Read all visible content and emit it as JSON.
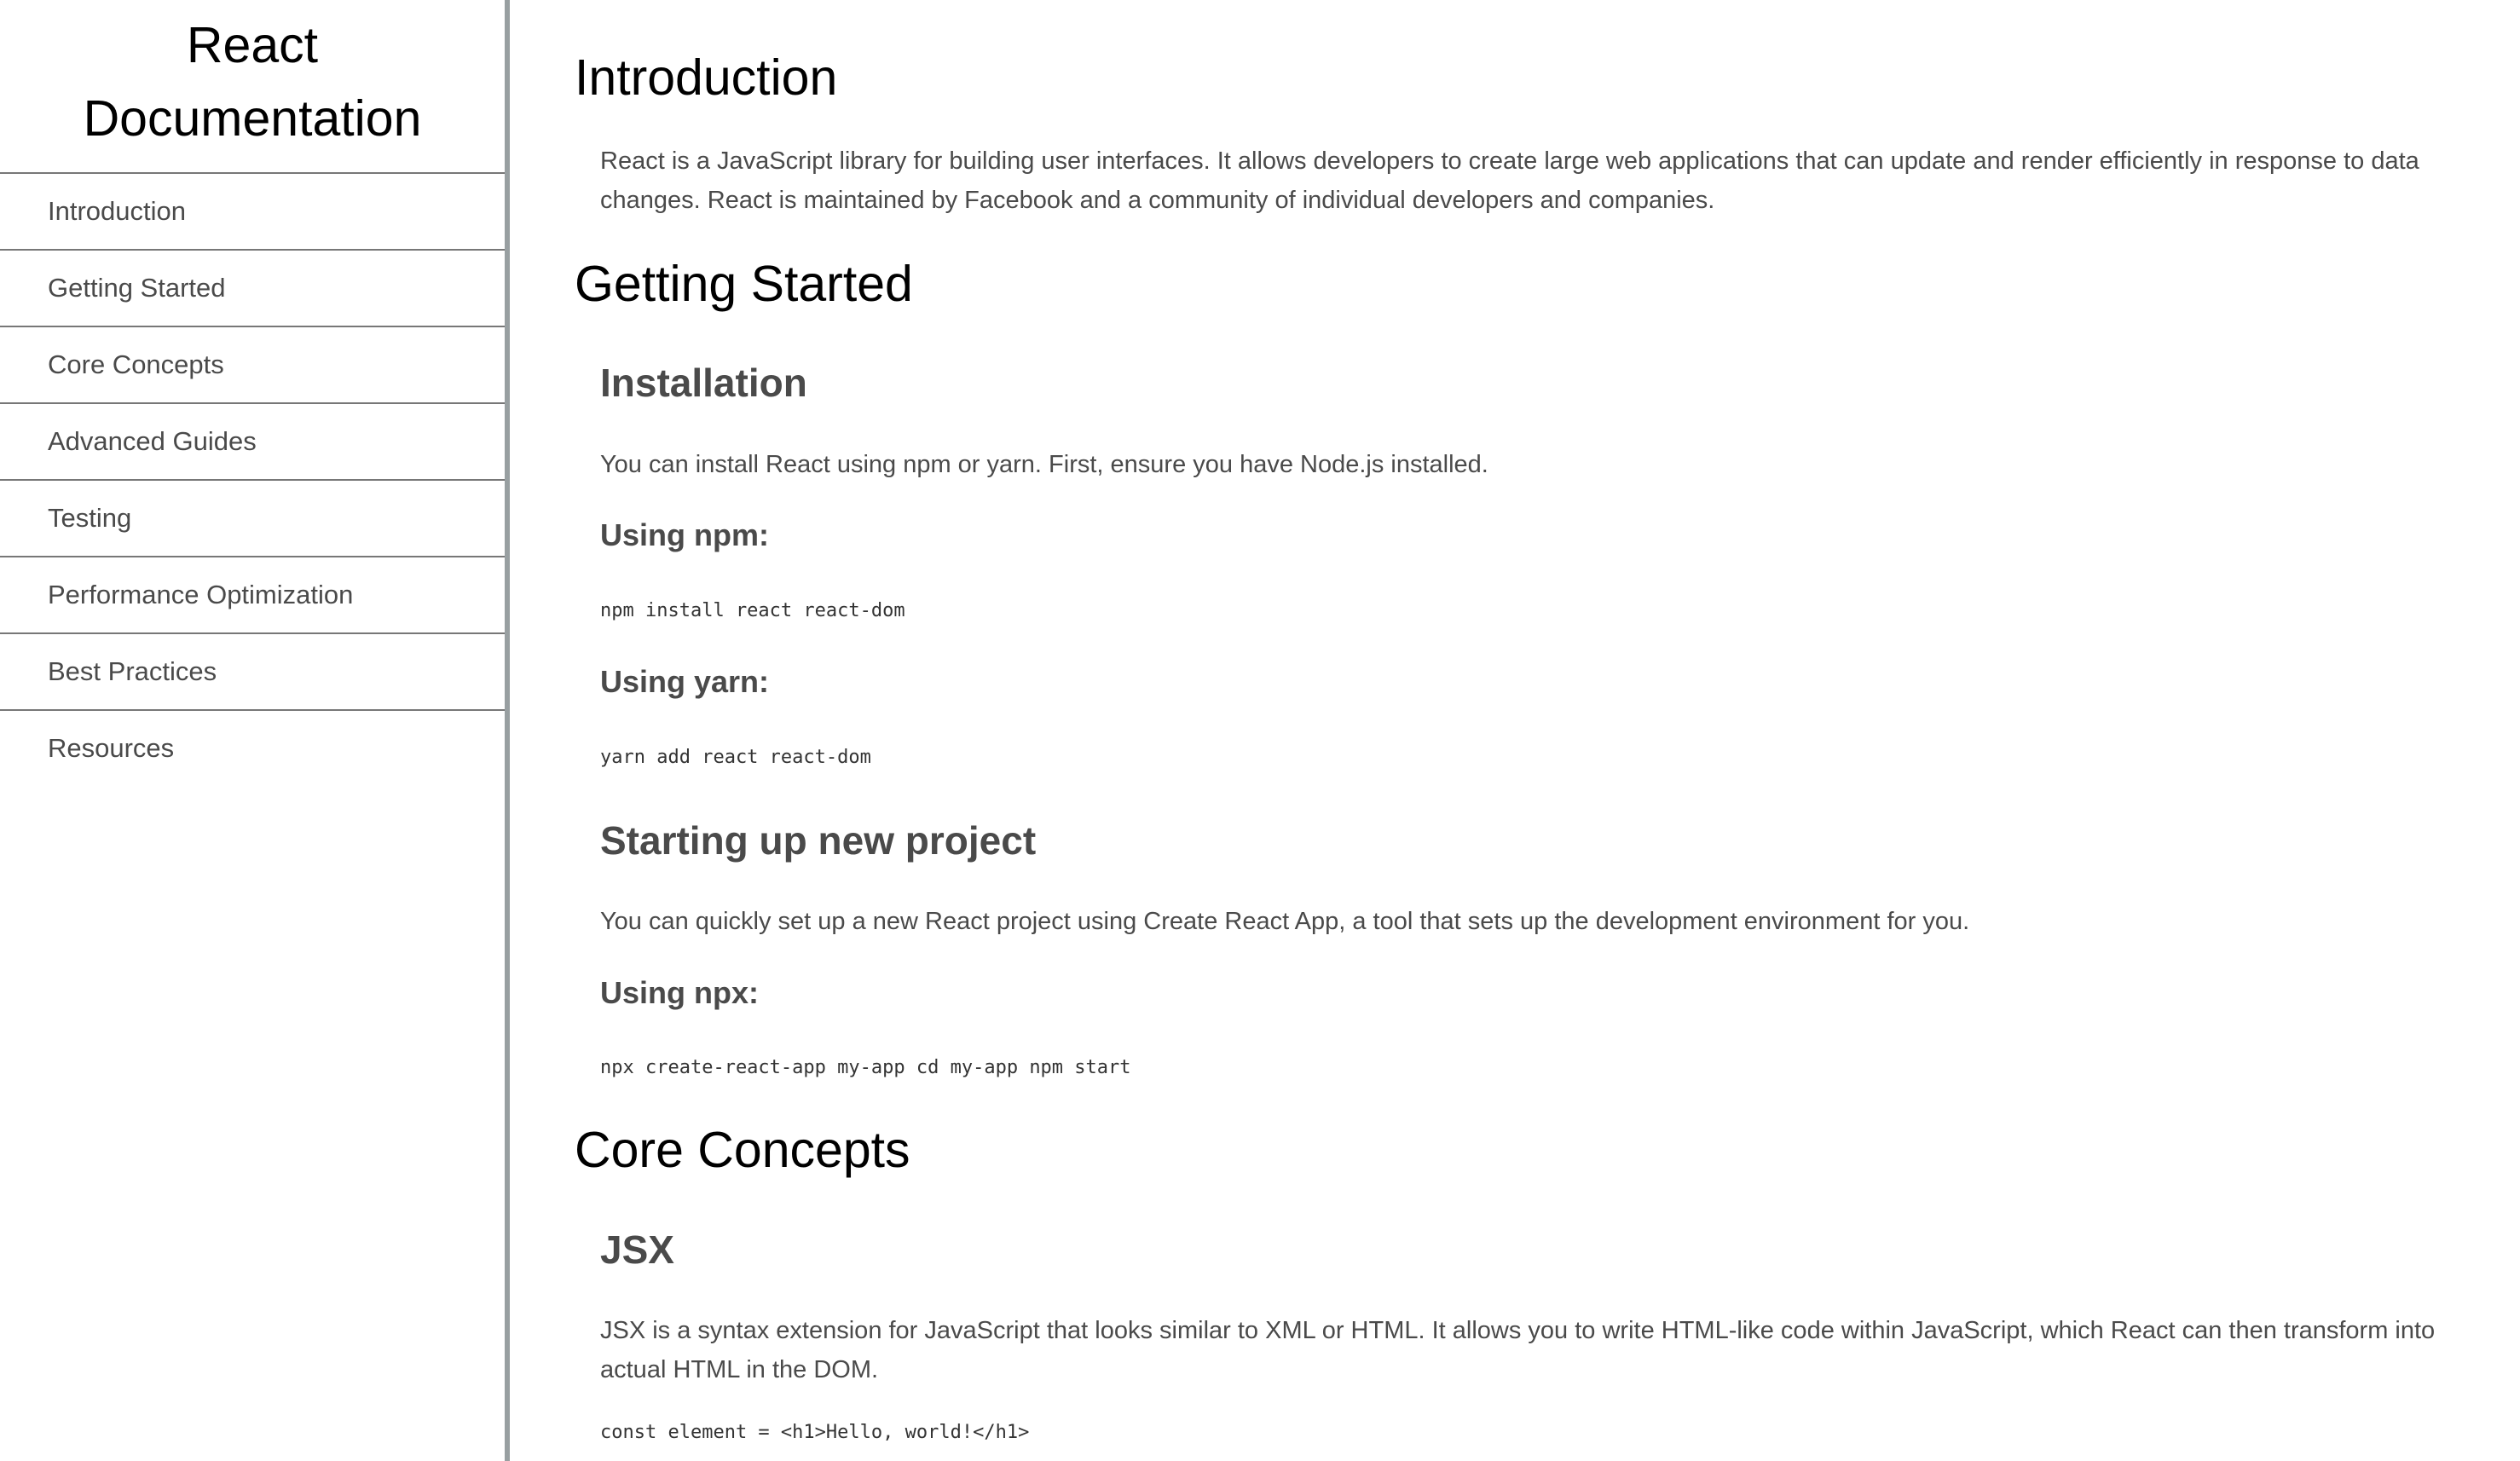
{
  "sidebar": {
    "title": "React\nDocumentation",
    "items": [
      {
        "label": "Introduction"
      },
      {
        "label": "Getting Started"
      },
      {
        "label": "Core Concepts"
      },
      {
        "label": "Advanced Guides"
      },
      {
        "label": "Testing"
      },
      {
        "label": "Performance Optimization"
      },
      {
        "label": "Best Practices"
      },
      {
        "label": "Resources"
      }
    ]
  },
  "main": {
    "introduction": {
      "title": "Introduction",
      "text": "React is a JavaScript library for building user interfaces. It allows developers to create large web applications that can update and render efficiently in response to data changes. React is maintained by Facebook and a community of individual developers and companies."
    },
    "getting_started": {
      "title": "Getting Started",
      "installation": {
        "title": "Installation",
        "text": "You can install React using npm or yarn. First, ensure you have Node.js installed.",
        "npm_title": "Using npm:",
        "npm_code": "npm install react react-dom",
        "yarn_title": "Using yarn:",
        "yarn_code": "yarn add react react-dom"
      },
      "new_project": {
        "title": "Starting up new project",
        "text": "You can quickly set up a new React project using Create React App, a tool that sets up the development environment for you.",
        "npx_title": "Using npx:",
        "npx_code": "npx create-react-app my-app cd my-app npm start"
      }
    },
    "core_concepts": {
      "title": "Core Concepts",
      "jsx": {
        "title": "JSX",
        "text": "JSX is a syntax extension for JavaScript that looks similar to XML or HTML. It allows you to write HTML-like code within JavaScript, which React can then transform into actual HTML in the DOM.",
        "code": "const element = <h1>Hello, world!</h1>"
      }
    }
  }
}
